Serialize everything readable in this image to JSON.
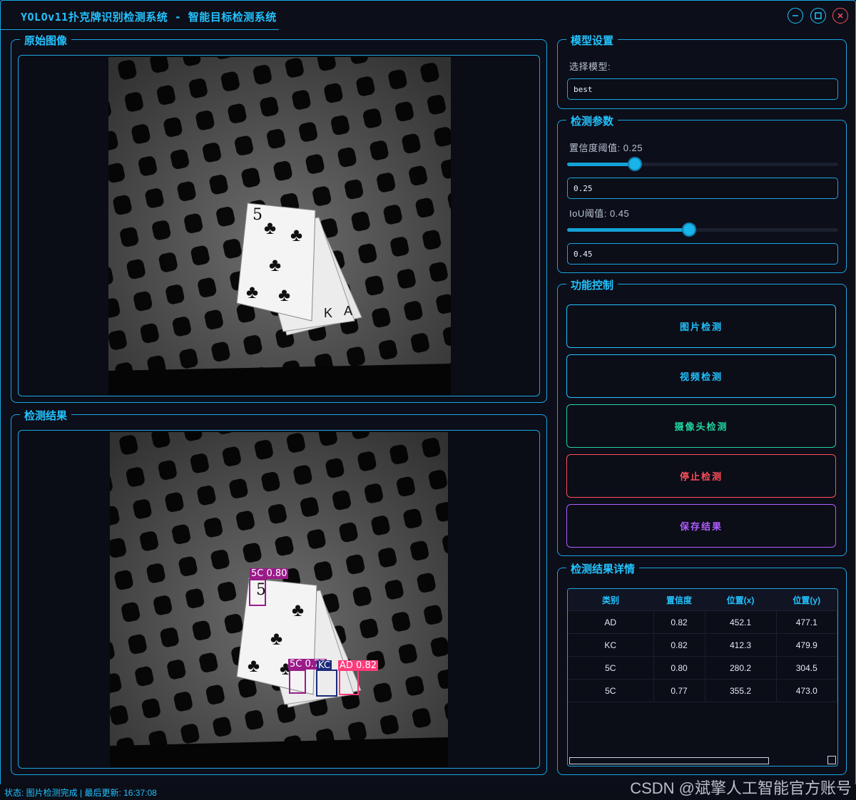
{
  "window": {
    "title": "YOLOv11扑克牌识别检测系统 - 智能目标检测系统",
    "controls": [
      "minimize-icon",
      "maximize-icon",
      "close-icon"
    ]
  },
  "original_panel": {
    "title": "原始图像"
  },
  "result_panel": {
    "title": "检测结果",
    "boxes": [
      {
        "label": "5C 0.80",
        "color": "#9b1b8a"
      },
      {
        "label": "5C 0.77",
        "color": "#9b1b8a"
      },
      {
        "label": "KC",
        "color": "#1b2a7a"
      },
      {
        "label": "AD 0.82",
        "color": "#ff3b7a"
      }
    ]
  },
  "model_settings": {
    "title": "模型设置",
    "select_label": "选择模型:",
    "model_value": "best"
  },
  "detection_params": {
    "title": "检测参数",
    "conf_label": "置信度阈值: 0.25",
    "conf_value": "0.25",
    "conf_level": 0.25,
    "iou_label": "IoU阈值: 0.45",
    "iou_value": "0.45",
    "iou_level": 0.45
  },
  "function_control": {
    "title": "功能控制",
    "buttons": [
      {
        "label": "图片检测",
        "color": "#22c3ff"
      },
      {
        "label": "视频检测",
        "color": "#22c3ff"
      },
      {
        "label": "摄像头检测",
        "color": "#21d3a0"
      },
      {
        "label": "停止检测",
        "color": "#ff4d5a"
      },
      {
        "label": "保存结果",
        "color": "#b05cff"
      }
    ]
  },
  "results_detail": {
    "title": "检测结果详情",
    "columns": [
      "类别",
      "置信度",
      "位置(x)",
      "位置(y)"
    ],
    "rows": [
      [
        "AD",
        "0.82",
        "452.1",
        "477.1"
      ],
      [
        "KC",
        "0.82",
        "412.3",
        "479.9"
      ],
      [
        "5C",
        "0.80",
        "280.2",
        "304.5"
      ],
      [
        "5C",
        "0.77",
        "355.2",
        "473.0"
      ]
    ]
  },
  "status": "状态: 图片检测完成 | 最后更新: 16:37:08",
  "watermark": "CSDN @斌擎人工智能官方账号"
}
